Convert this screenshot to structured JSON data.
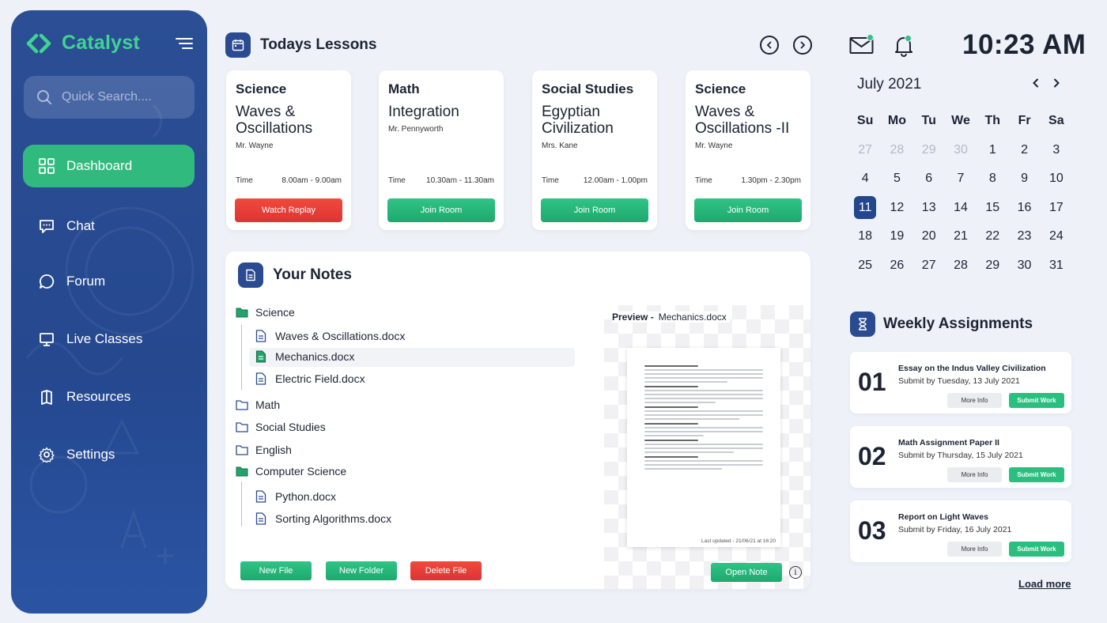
{
  "app": {
    "name": "Catalyst",
    "brand_color": "#3fd48f",
    "accent": "#31ba7e",
    "sidebar_color": "#2a4b91"
  },
  "search": {
    "placeholder": "Quick Search...."
  },
  "nav": {
    "items": [
      {
        "label": "Dashboard",
        "icon": "grid-icon",
        "active": true
      },
      {
        "label": "Chat",
        "icon": "chat-icon"
      },
      {
        "label": "Forum",
        "icon": "forum-icon"
      },
      {
        "label": "Live Classes",
        "icon": "screen-icon"
      },
      {
        "label": "Resources",
        "icon": "book-icon"
      },
      {
        "label": "Settings",
        "icon": "gear-icon"
      }
    ]
  },
  "lessons": {
    "title": "Todays Lessons",
    "time_label": "Time",
    "cards": [
      {
        "subject": "Science",
        "topic": "Waves & Oscillations",
        "teacher": "Mr. Wayne",
        "time": "8.00am - 9.00am",
        "button": "Watch Replay"
      },
      {
        "subject": "Math",
        "topic": "Integration",
        "teacher": "Mr. Pennyworth",
        "time": "10.30am - 11.30am",
        "button": "Join Room"
      },
      {
        "subject": "Social Studies",
        "topic": "Egyptian Civilization",
        "teacher": "Mrs. Kane",
        "time": "12.00am - 1.00pm",
        "button": "Join Room"
      },
      {
        "subject": "Science",
        "topic": "Waves & Oscillations -II",
        "teacher": "Mr. Wayne",
        "time": "1.30pm - 2.30pm",
        "button": "Join Room"
      }
    ]
  },
  "notes": {
    "title": "Your Notes",
    "tree": [
      {
        "name": "Science",
        "type": "folder",
        "open": true
      },
      {
        "name": "Waves & Oscillations.docx",
        "type": "file"
      },
      {
        "name": "Mechanics.docx",
        "type": "file",
        "selected": true
      },
      {
        "name": "Electric Field.docx",
        "type": "file"
      },
      {
        "name": "Math",
        "type": "folder"
      },
      {
        "name": "Social Studies",
        "type": "folder"
      },
      {
        "name": "English",
        "type": "folder"
      },
      {
        "name": "Computer Science",
        "type": "folder",
        "open": true
      },
      {
        "name": "Python.docx",
        "type": "file"
      },
      {
        "name": "Sorting Algorithms.docx",
        "type": "file"
      }
    ],
    "preview_label": "Preview -",
    "preview_file": "Mechanics.docx",
    "last_updated": "Last updated - 21/06/21 at 16:20",
    "buttons": {
      "new_file": "New File",
      "new_folder": "New Folder",
      "delete_file": "Delete File",
      "open_note": "Open Note"
    }
  },
  "clock": {
    "time": "10:23 AM"
  },
  "calendar": {
    "month": "July 2021",
    "weekdays": [
      "Su",
      "Mo",
      "Tu",
      "We",
      "Th",
      "Fr",
      "Sa"
    ],
    "days": [
      "27",
      "28",
      "29",
      "30",
      "1",
      "2",
      "3",
      "4",
      "5",
      "6",
      "7",
      "8",
      "9",
      "10",
      "11",
      "12",
      "13",
      "14",
      "15",
      "16",
      "17",
      "18",
      "19",
      "20",
      "21",
      "22",
      "23",
      "24",
      "25",
      "26",
      "27",
      "28",
      "29",
      "30",
      "31"
    ],
    "muted_count": 4,
    "today": "11"
  },
  "assignments": {
    "title": "Weekly Assignments",
    "more_info": "More Info",
    "submit": "Submit Work",
    "items": [
      {
        "num": "01",
        "title": "Essay on the Indus Valley Civilization",
        "due": "Submit by Tuesday, 13 July 2021"
      },
      {
        "num": "02",
        "title": "Math Assignment Paper II",
        "due": "Submit by Thursday, 15 July 2021"
      },
      {
        "num": "03",
        "title": "Report on Light Waves",
        "due": "Submit by Friday, 16 July 2021"
      }
    ],
    "load_more": "Load more"
  }
}
